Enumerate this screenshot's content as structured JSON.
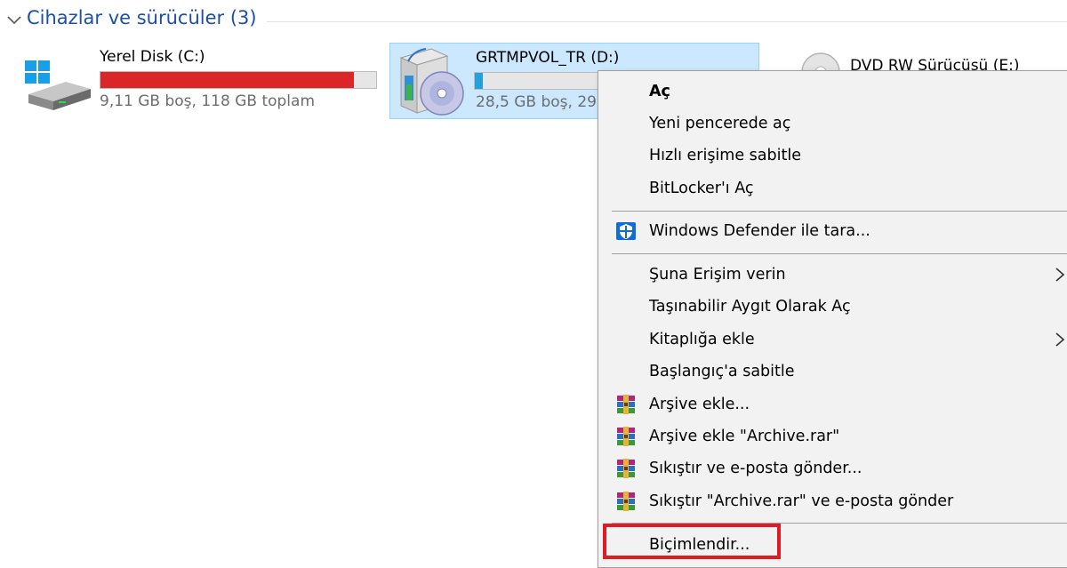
{
  "section": {
    "title": "Cihazlar ve sürücüler (3)"
  },
  "drives": [
    {
      "name": "Yerel Disk (C:)",
      "usage": "9,11 GB boş, 118 GB toplam",
      "used_fraction": 0.92,
      "bar_color": "#da2626",
      "icon": "hard-drive-windows-icon"
    },
    {
      "name": "GRTMPVOL_TR (D:)",
      "usage": "28,5 GB boş, 29,",
      "used_fraction": 0.03,
      "bar_color": "#26a0da",
      "icon": "setup-disc-icon",
      "selected": true
    },
    {
      "name": "DVD RW Sürücüsü (E:)",
      "icon": "dvd-drive-icon"
    }
  ],
  "context_menu": {
    "items": [
      {
        "label": "Aç",
        "bold": true
      },
      {
        "label": "Yeni pencerede aç"
      },
      {
        "label": "Hızlı erişime sabitle"
      },
      {
        "label": "BitLocker'ı Aç"
      },
      {
        "label": "Windows Defender ile tara...",
        "icon": "windows-defender-icon"
      },
      {
        "label": "Şuna Erişim verin",
        "submenu": true
      },
      {
        "label": "Taşınabilir Aygıt Olarak Aç"
      },
      {
        "label": "Kitaplığa ekle",
        "submenu": true
      },
      {
        "label": "Başlangıç'a sabitle"
      },
      {
        "label": "Arşive ekle...",
        "icon": "winrar-icon"
      },
      {
        "label": "Arşive ekle \"Archive.rar\"",
        "icon": "winrar-icon"
      },
      {
        "label": "Sıkıştır ve e-posta gönder...",
        "icon": "winrar-icon"
      },
      {
        "label": "Sıkıştır \"Archive.rar\" ve e-posta gönder",
        "icon": "winrar-icon"
      },
      {
        "label": "Biçimlendir...",
        "highlighted": true
      }
    ]
  },
  "colors": {
    "accent": "#1e4fa8",
    "highlight": "#e21b23",
    "selection": "#cce8ff"
  }
}
